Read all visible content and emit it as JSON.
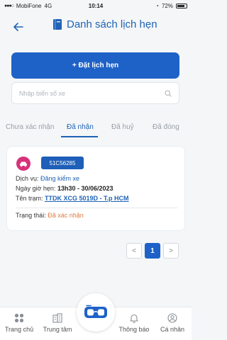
{
  "status_bar": {
    "carrier": "MobiFone",
    "network": "4G",
    "time": "10:14",
    "battery": "72%"
  },
  "header": {
    "title": "Danh sách lịch hẹn"
  },
  "actions": {
    "book_label": "+ Đặt lịch hẹn"
  },
  "search": {
    "placeholder": "Nhập biển số xe"
  },
  "tabs": [
    {
      "label": "Chưa xác nhận"
    },
    {
      "label": "Đã nhận"
    },
    {
      "label": "Đã huỷ"
    },
    {
      "label": "Đã đóng"
    }
  ],
  "appointment": {
    "plate": "51C56285",
    "service_label": "Dịch vụ:",
    "service_value": "Đăng kiểm xe",
    "date_label": "Ngày giờ hẹn:",
    "date_value": "13h30 - 30/06/2023",
    "station_label": "Tên trạm:",
    "station_value": "TTDK XCG 5019D - T.p HCM",
    "status_label": "Trạng thái:",
    "status_value": "Đã xác nhận"
  },
  "pagination": {
    "prev": "<",
    "current": "1",
    "next": ">"
  },
  "bottom_nav": [
    {
      "label": "Trang chủ",
      "icon": "grid-icon"
    },
    {
      "label": "Trung tâm",
      "icon": "building-icon"
    },
    {
      "label": "Thông báo",
      "icon": "bell-icon"
    },
    {
      "label": "Cá nhân",
      "icon": "user-icon"
    }
  ],
  "colors": {
    "primary": "#1e62c8",
    "accent_pink": "#d6337a",
    "status_orange": "#e07a3f"
  }
}
